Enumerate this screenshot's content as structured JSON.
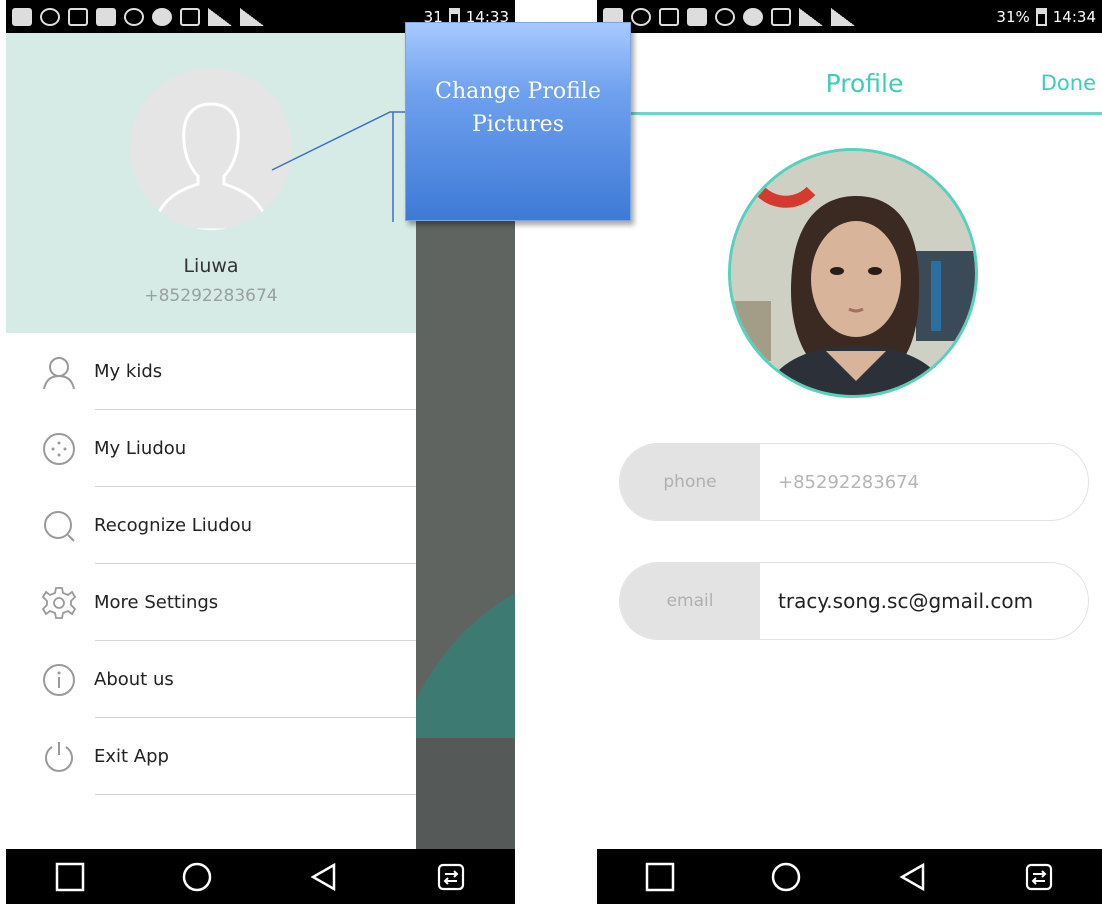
{
  "left_screen": {
    "status_bar": {
      "battery": "31",
      "time": "14:33"
    },
    "drawer": {
      "user_name": "Liuwa",
      "user_phone": "+85292283674",
      "menu": [
        {
          "label": "My kids",
          "icon": "person-icon"
        },
        {
          "label": "My Liudou",
          "icon": "liudou-icon"
        },
        {
          "label": "Recognize Liudou",
          "icon": "search-icon"
        },
        {
          "label": "More Settings",
          "icon": "gear-icon"
        },
        {
          "label": "About us",
          "icon": "info-icon"
        },
        {
          "label": "Exit App",
          "icon": "power-icon"
        }
      ]
    }
  },
  "callout": {
    "line1": "Change Profile",
    "line2": "Pictures"
  },
  "right_screen": {
    "status_bar": {
      "battery": "31%",
      "time": "14:34"
    },
    "header": {
      "title": "Profile",
      "done_label": "Done"
    },
    "fields": {
      "phone_label": "phone",
      "phone_value": "+85292283674",
      "email_label": "email",
      "email_value": "tracy.song.sc@gmail.com"
    }
  },
  "colors": {
    "accent": "#3fcdb8",
    "drawer_header": "#d6ebe6",
    "callout": "#4a86e0"
  }
}
